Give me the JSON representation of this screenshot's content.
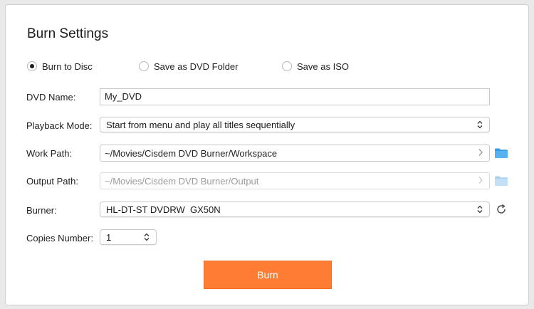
{
  "dialog": {
    "title": "Burn Settings",
    "burn_button_label": "Burn",
    "accent_color": "#ff7c34"
  },
  "output_mode": {
    "selected": "burn_to_disc",
    "options": [
      {
        "id": "burn_to_disc",
        "label": "Burn to Disc"
      },
      {
        "id": "save_as_dvd_folder",
        "label": "Save as DVD Folder"
      },
      {
        "id": "save_as_iso",
        "label": "Save as ISO"
      }
    ]
  },
  "fields": {
    "dvd_name": {
      "label": "DVD Name:",
      "value": "My_DVD"
    },
    "playback_mode": {
      "label": "Playback Mode:",
      "value": "Start from menu and play all titles sequentially"
    },
    "work_path": {
      "label": "Work Path:",
      "value": "~/Movies/Cisdem DVD Burner/Workspace"
    },
    "output_path": {
      "label": "Output Path:",
      "value": "~/Movies/Cisdem DVD Burner/Output",
      "disabled": true
    },
    "burner": {
      "label": "Burner:",
      "value": "HL-DT-ST DVDRW  GX50N"
    },
    "copies_number": {
      "label": "Copies Number:",
      "value": "1"
    }
  },
  "icons": {
    "folder": "folder-icon",
    "refresh": "refresh-icon",
    "chevron": "chevron-right-icon",
    "stepper": "up-down-arrows-icon"
  }
}
